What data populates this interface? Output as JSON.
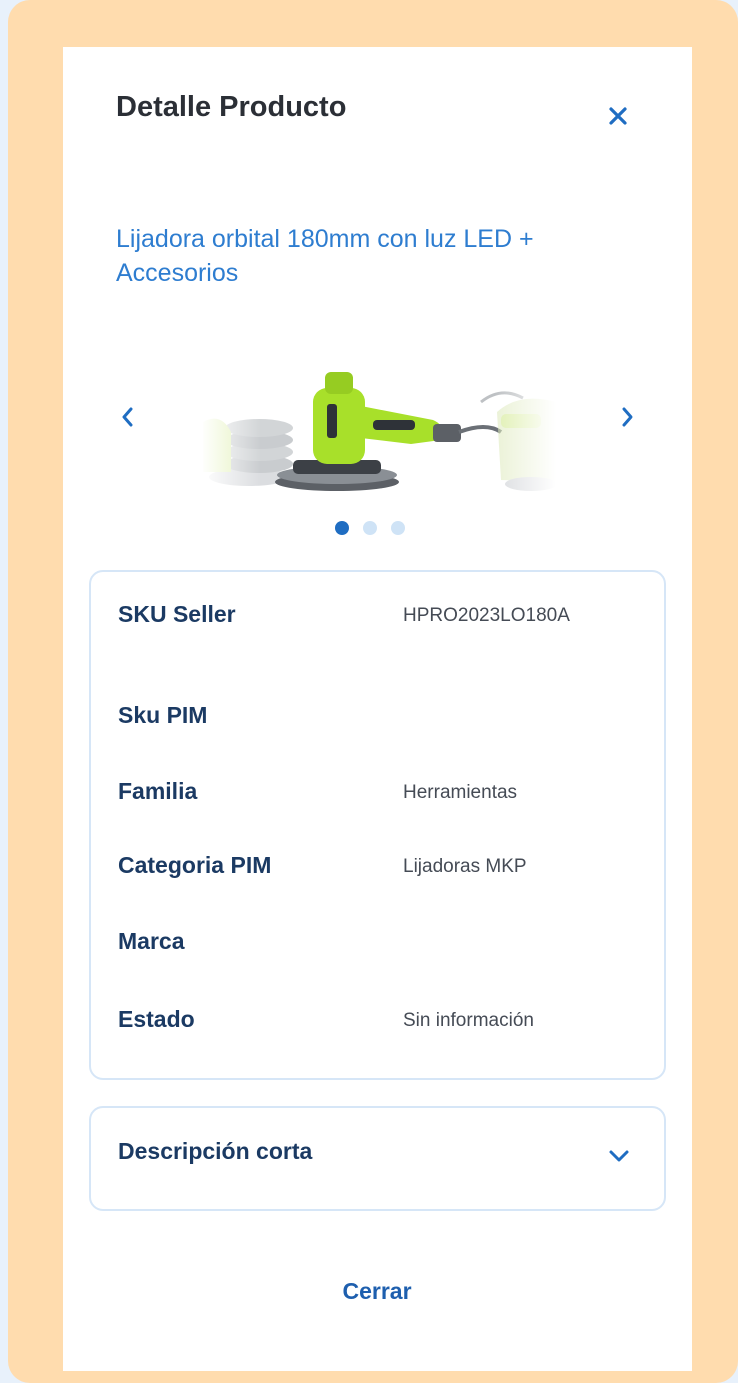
{
  "modal": {
    "title": "Detalle Producto",
    "close_icon": "close-icon",
    "product_name": "Lijadora orbital 180mm con luz LED + Accesorios"
  },
  "carousel": {
    "prev_icon": "chevron-left-icon",
    "next_icon": "chevron-right-icon",
    "active_index": 0,
    "dot_count": 3
  },
  "details": {
    "rows": [
      {
        "label": "SKU Seller",
        "value": "HPRO2023LO180A"
      },
      {
        "label": "Sku PIM",
        "value": ""
      },
      {
        "label": "Familia",
        "value": "Herramientas"
      },
      {
        "label": "Categoria PIM",
        "value": "Lijadoras MKP"
      },
      {
        "label": "Marca",
        "value": ""
      },
      {
        "label": "Estado",
        "value": "Sin información"
      }
    ]
  },
  "description": {
    "label": "Descripción corta",
    "icon": "chevron-down-icon"
  },
  "footer": {
    "close_label": "Cerrar"
  },
  "colors": {
    "accent": "#1f6dc2",
    "link_text": "#2e7dd0",
    "label_text": "#1b3a63",
    "frame": "#ffdcae",
    "product_green": "#a8e02a"
  }
}
